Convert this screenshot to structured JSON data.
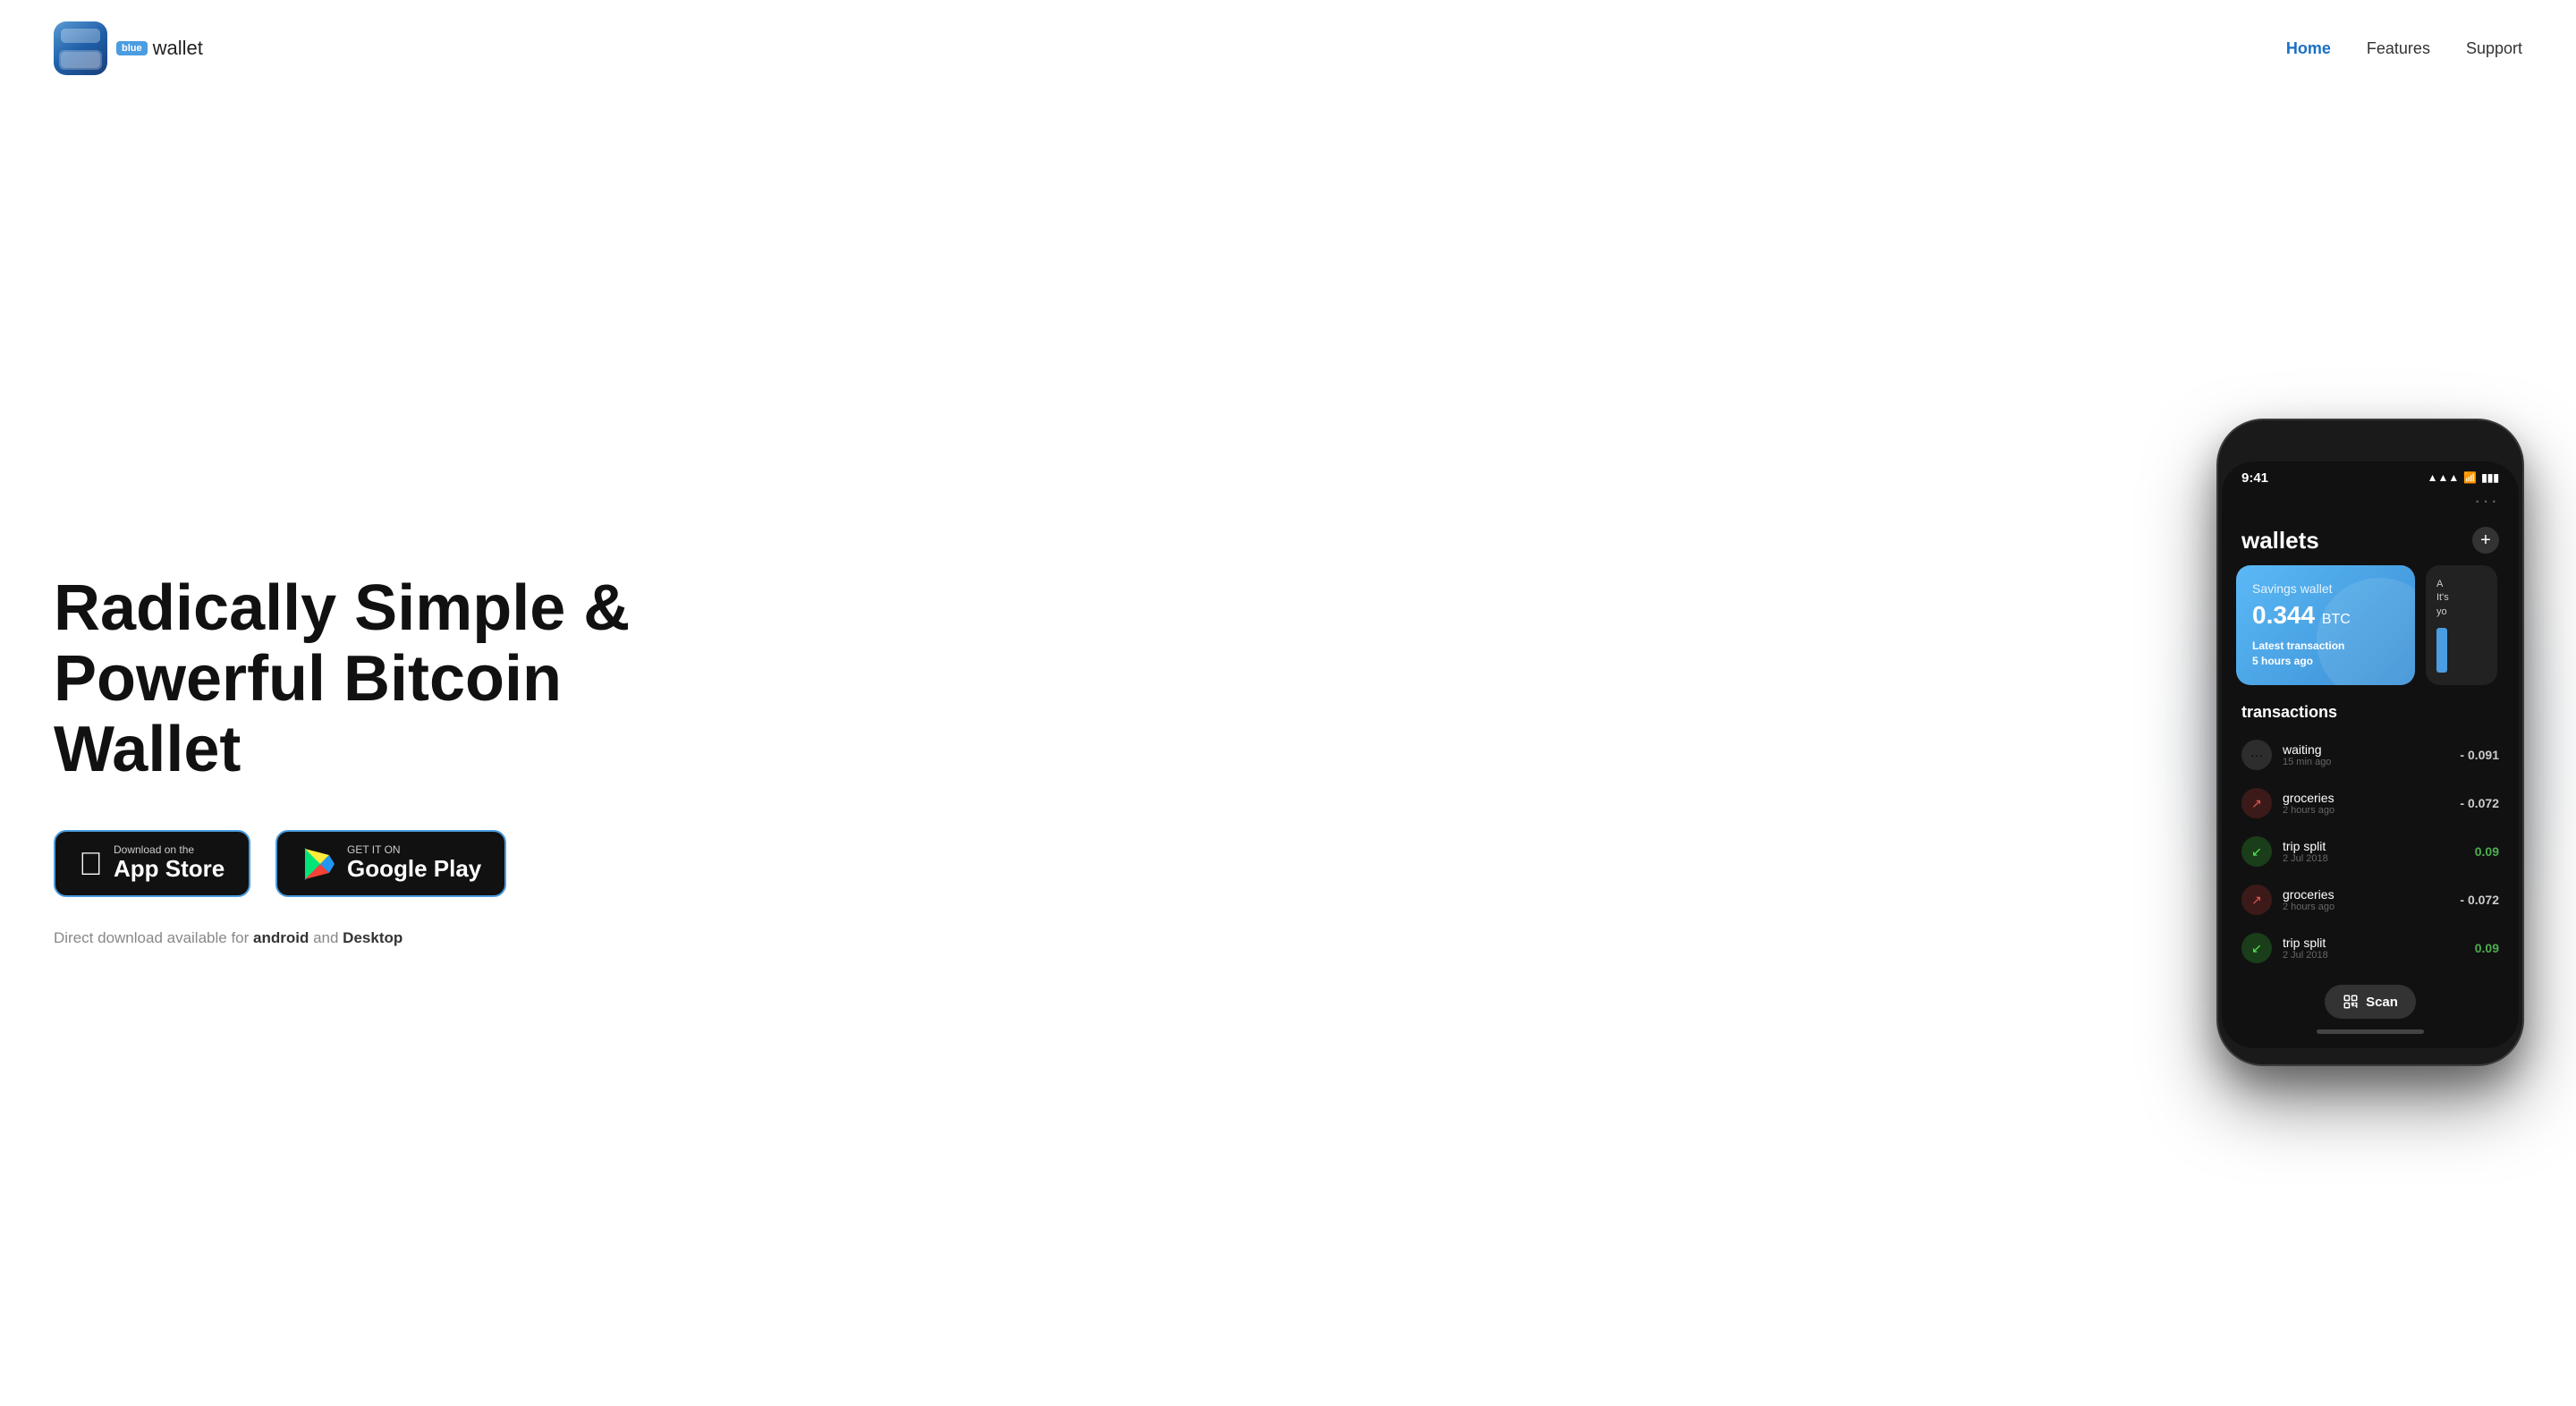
{
  "nav": {
    "logo_blue": "blue",
    "logo_wallet": "wallet",
    "links": [
      {
        "label": "Home",
        "active": true
      },
      {
        "label": "Features",
        "active": false
      },
      {
        "label": "Support",
        "active": false
      }
    ]
  },
  "hero": {
    "title_line1": "Radically Simple &",
    "title_line2": "Powerful Bitcoin Wallet",
    "appstore": {
      "sub": "Download on the",
      "main": "App Store"
    },
    "googleplay": {
      "sub": "GET IT ON",
      "main": "Google Play"
    },
    "direct_prefix": "Direct download available for ",
    "direct_android": "android",
    "direct_middle": " and ",
    "direct_desktop": "Desktop"
  },
  "phone": {
    "status_time": "9:41",
    "status_signal": "▲▲▲",
    "status_wifi": "WiFi",
    "status_battery": "▮▮▮",
    "dots": "···",
    "wallets_title": "wallets",
    "add_btn": "+",
    "wallet_card": {
      "name": "Savings wallet",
      "amount": "0.344",
      "unit": "BTC",
      "latest_label": "Latest transaction",
      "latest_time": "5 hours ago"
    },
    "wallet_alt": {
      "text_line1": "A",
      "text_line2": "It's",
      "text_line3": "yo"
    },
    "transactions_title": "transactions",
    "transactions": [
      {
        "icon": "···",
        "icon_type": "pending",
        "name": "waiting",
        "time": "15 min ago",
        "amount": "- 0.091",
        "amount_type": "negative"
      },
      {
        "icon": "↗",
        "icon_type": "out",
        "name": "groceries",
        "time": "2 hours ago",
        "amount": "- 0.072",
        "amount_type": "negative"
      },
      {
        "icon": "↙",
        "icon_type": "in",
        "name": "trip split",
        "time": "2 Jul 2018",
        "amount": "0.09",
        "amount_type": "positive"
      },
      {
        "icon": "↗",
        "icon_type": "out",
        "name": "groceries",
        "time": "2 hours ago",
        "amount": "- 0.072",
        "amount_type": "negative"
      },
      {
        "icon": "↙",
        "icon_type": "in",
        "name": "trip split",
        "time": "2 Jul 2018",
        "amount": "0.09",
        "amount_type": "positive"
      }
    ],
    "scan_label": "Scan"
  }
}
